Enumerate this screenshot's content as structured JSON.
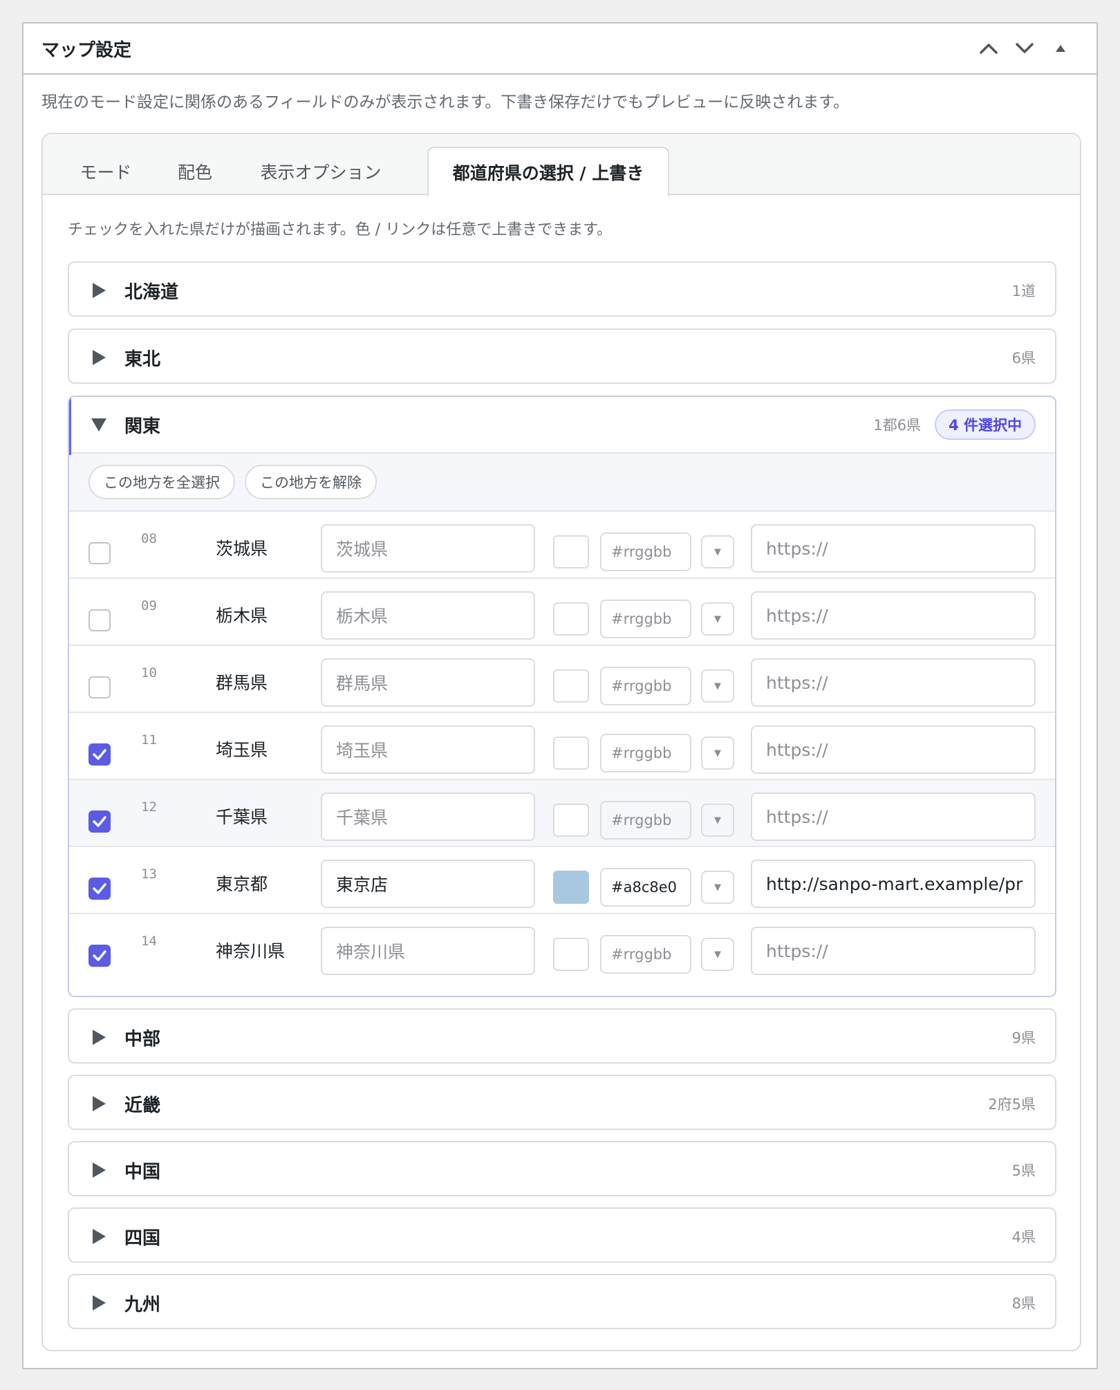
{
  "postbox": {
    "title": "マップ設定",
    "description": "現在のモード設定に関係のあるフィールドのみが表示されます。下書き保存だけでもプレビューに反映されます。"
  },
  "tabs": [
    {
      "label": "モード",
      "active": false
    },
    {
      "label": "配色",
      "active": false
    },
    {
      "label": "表示オプション",
      "active": false
    },
    {
      "label": "都道府県の選択 / 上書き",
      "active": true
    }
  ],
  "note": "チェックを入れた県だけが描画されます。色 / リンクは任意で上書きできます。",
  "regions": [
    {
      "name": "北海道",
      "count": "1道"
    },
    {
      "name": "東北",
      "count": "6県"
    },
    {
      "name": "関東",
      "count": "1都6県",
      "badge": "4 件選択中",
      "open": true
    },
    {
      "name": "中部",
      "count": "9県"
    },
    {
      "name": "近畿",
      "count": "2府5県"
    },
    {
      "name": "中国",
      "count": "5県"
    },
    {
      "name": "四国",
      "count": "4県"
    },
    {
      "name": "九州",
      "count": "8県"
    }
  ],
  "bulk": {
    "select_all": "この地方を全選択",
    "clear": "この地方を解除"
  },
  "prefectures": [
    {
      "code": "08",
      "name": "茨城県",
      "label": "茨城県",
      "label_filled": false,
      "hex": "#rrggbb",
      "color": "",
      "url": "https://",
      "url_filled": false,
      "checked": false
    },
    {
      "code": "09",
      "name": "栃木県",
      "label": "栃木県",
      "label_filled": false,
      "hex": "#rrggbb",
      "color": "",
      "url": "https://",
      "url_filled": false,
      "checked": false
    },
    {
      "code": "10",
      "name": "群馬県",
      "label": "群馬県",
      "label_filled": false,
      "hex": "#rrggbb",
      "color": "",
      "url": "https://",
      "url_filled": false,
      "checked": false
    },
    {
      "code": "11",
      "name": "埼玉県",
      "label": "埼玉県",
      "label_filled": false,
      "hex": "#rrggbb",
      "color": "",
      "url": "https://",
      "url_filled": false,
      "checked": true
    },
    {
      "code": "12",
      "name": "千葉県",
      "label": "千葉県",
      "label_filled": false,
      "hex": "#rrggbb",
      "color": "",
      "url": "https://",
      "url_filled": false,
      "checked": true
    },
    {
      "code": "13",
      "name": "東京都",
      "label": "東京店",
      "label_filled": true,
      "hex": "#a8c8e0",
      "color": "#a8c8e0",
      "url": "http://sanpo-mart.example/pr",
      "url_filled": true,
      "checked": true
    },
    {
      "code": "14",
      "name": "神奈川県",
      "label": "神奈川県",
      "label_filled": false,
      "hex": "#rrggbb",
      "color": "",
      "url": "https://",
      "url_filled": false,
      "checked": true
    }
  ],
  "dropdown_glyph": "▼",
  "colors": {
    "accent": "#5b5be6",
    "badge_text": "#4f46e5",
    "open_border": "#6366f1"
  },
  "icons": {
    "collapse_up": "chevron-up-icon",
    "move_down": "chevron-down-icon",
    "toggle": "triangle-up-icon"
  }
}
